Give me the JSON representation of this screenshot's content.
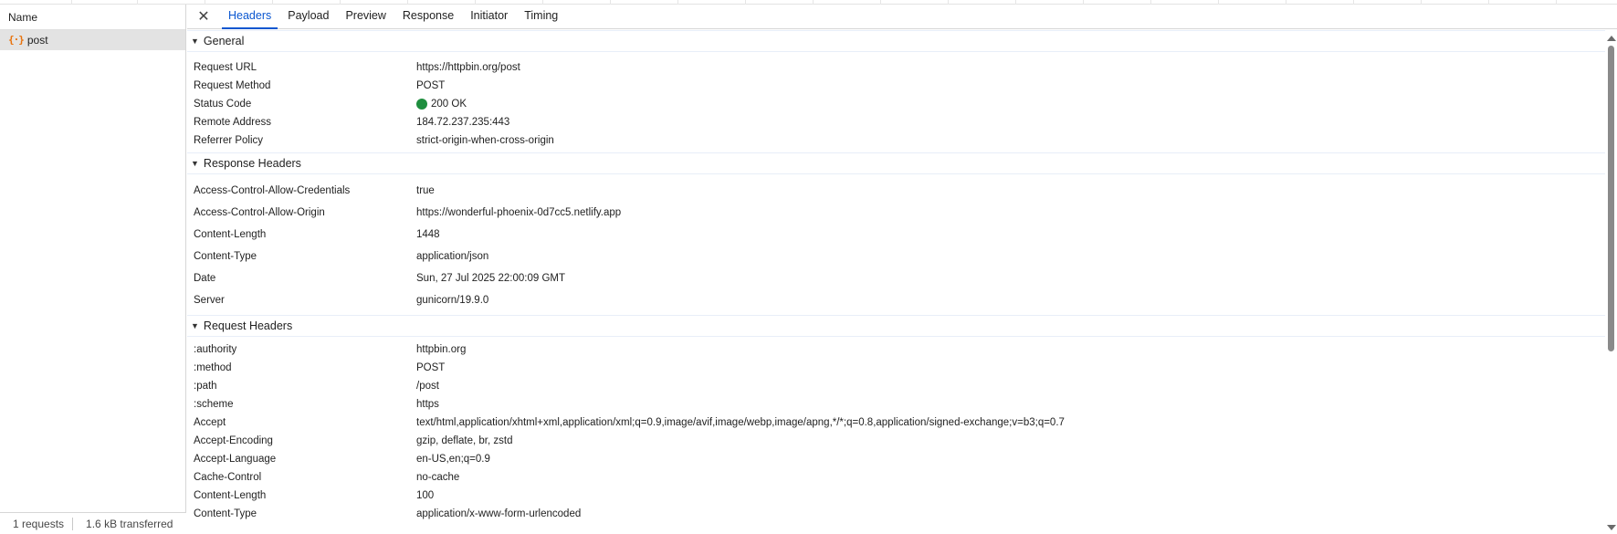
{
  "left_pane": {
    "header": "Name",
    "requests": [
      {
        "icon": "{·}",
        "name": "post"
      }
    ],
    "status": {
      "requests": "1 requests",
      "transferred": "1.6 kB transferred"
    }
  },
  "tabs": {
    "close_label": "✕",
    "items": [
      "Headers",
      "Payload",
      "Preview",
      "Response",
      "Initiator",
      "Timing"
    ],
    "active": "Headers"
  },
  "sections": {
    "general": {
      "title": "General",
      "rows": [
        {
          "key": "Request URL",
          "value": "https://httpbin.org/post"
        },
        {
          "key": "Request Method",
          "value": "POST"
        },
        {
          "key": "Status Code",
          "value": "200 OK"
        },
        {
          "key": "Remote Address",
          "value": "184.72.237.235:443"
        },
        {
          "key": "Referrer Policy",
          "value": "strict-origin-when-cross-origin"
        }
      ]
    },
    "response_headers": {
      "title": "Response Headers",
      "rows": [
        {
          "key": "Access-Control-Allow-Credentials",
          "value": "true"
        },
        {
          "key": "Access-Control-Allow-Origin",
          "value": "https://wonderful-phoenix-0d7cc5.netlify.app"
        },
        {
          "key": "Content-Length",
          "value": "1448"
        },
        {
          "key": "Content-Type",
          "value": "application/json"
        },
        {
          "key": "Date",
          "value": "Sun, 27 Jul 2025 22:00:09 GMT"
        },
        {
          "key": "Server",
          "value": "gunicorn/19.9.0"
        }
      ]
    },
    "request_headers": {
      "title": "Request Headers",
      "rows": [
        {
          "key": ":authority",
          "value": "httpbin.org"
        },
        {
          "key": ":method",
          "value": "POST"
        },
        {
          "key": ":path",
          "value": "/post"
        },
        {
          "key": ":scheme",
          "value": "https"
        },
        {
          "key": "Accept",
          "value": "text/html,application/xhtml+xml,application/xml;q=0.9,image/avif,image/webp,image/apng,*/*;q=0.8,application/signed-exchange;v=b3;q=0.7"
        },
        {
          "key": "Accept-Encoding",
          "value": "gzip, deflate, br, zstd"
        },
        {
          "key": "Accept-Language",
          "value": "en-US,en;q=0.9"
        },
        {
          "key": "Cache-Control",
          "value": "no-cache"
        },
        {
          "key": "Content-Length",
          "value": "100"
        },
        {
          "key": "Content-Type",
          "value": "application/x-www-form-urlencoded"
        }
      ]
    }
  },
  "colors": {
    "accent": "#0b57d0",
    "status_ok": "#1e8e3e",
    "doc_icon": "#e8710a"
  }
}
